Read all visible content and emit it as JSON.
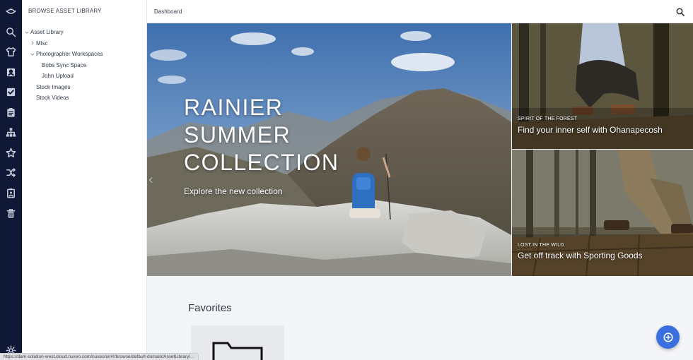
{
  "rail": {
    "icons": [
      "logo-icon",
      "search-icon",
      "shirt-icon",
      "contact-card-icon",
      "task-checkbox-icon",
      "clipboard-icon",
      "hierarchy-icon",
      "star-icon",
      "shuffle-icon",
      "clipboard-person-icon",
      "trash-icon",
      "settings-icon"
    ]
  },
  "tree": {
    "title": "BROWSE ASSET LIBRARY",
    "items": [
      {
        "label": "Asset Library",
        "level": 0,
        "caret": "down"
      },
      {
        "label": "Misc",
        "level": 1,
        "caret": "right"
      },
      {
        "label": "Photographer Workspaces",
        "level": 1,
        "caret": "down"
      },
      {
        "label": "Bobs Sync Space",
        "level": 2,
        "caret": ""
      },
      {
        "label": "John Upload",
        "level": 2,
        "caret": ""
      },
      {
        "label": "Stock Images",
        "level": 1,
        "caret": ""
      },
      {
        "label": "Stock Videos",
        "level": 1,
        "caret": ""
      }
    ]
  },
  "header": {
    "breadcrumb": "Dashboard"
  },
  "hero": {
    "title_line1": "RAINIER",
    "title_line2": "SUMMER",
    "title_line3": "COLLECTION",
    "subtitle": "Explore the new collection"
  },
  "tiles": [
    {
      "kicker": "SPIRIT OF THE FOREST",
      "caption": "Find your inner self with Ohanapecosh"
    },
    {
      "kicker": "LOST IN THE WILD",
      "caption": "Get off track with Sporting Goods"
    }
  ],
  "favorites": {
    "title": "Favorites"
  },
  "status_url": "https://dam-solution-west.cloud.nuxeo.com/nuxeo/ui/#!/browse/default-domain/AssetLibrary/...",
  "colors": {
    "rail_bg": "#0f1835",
    "fab_bg": "#3a6fe0"
  }
}
